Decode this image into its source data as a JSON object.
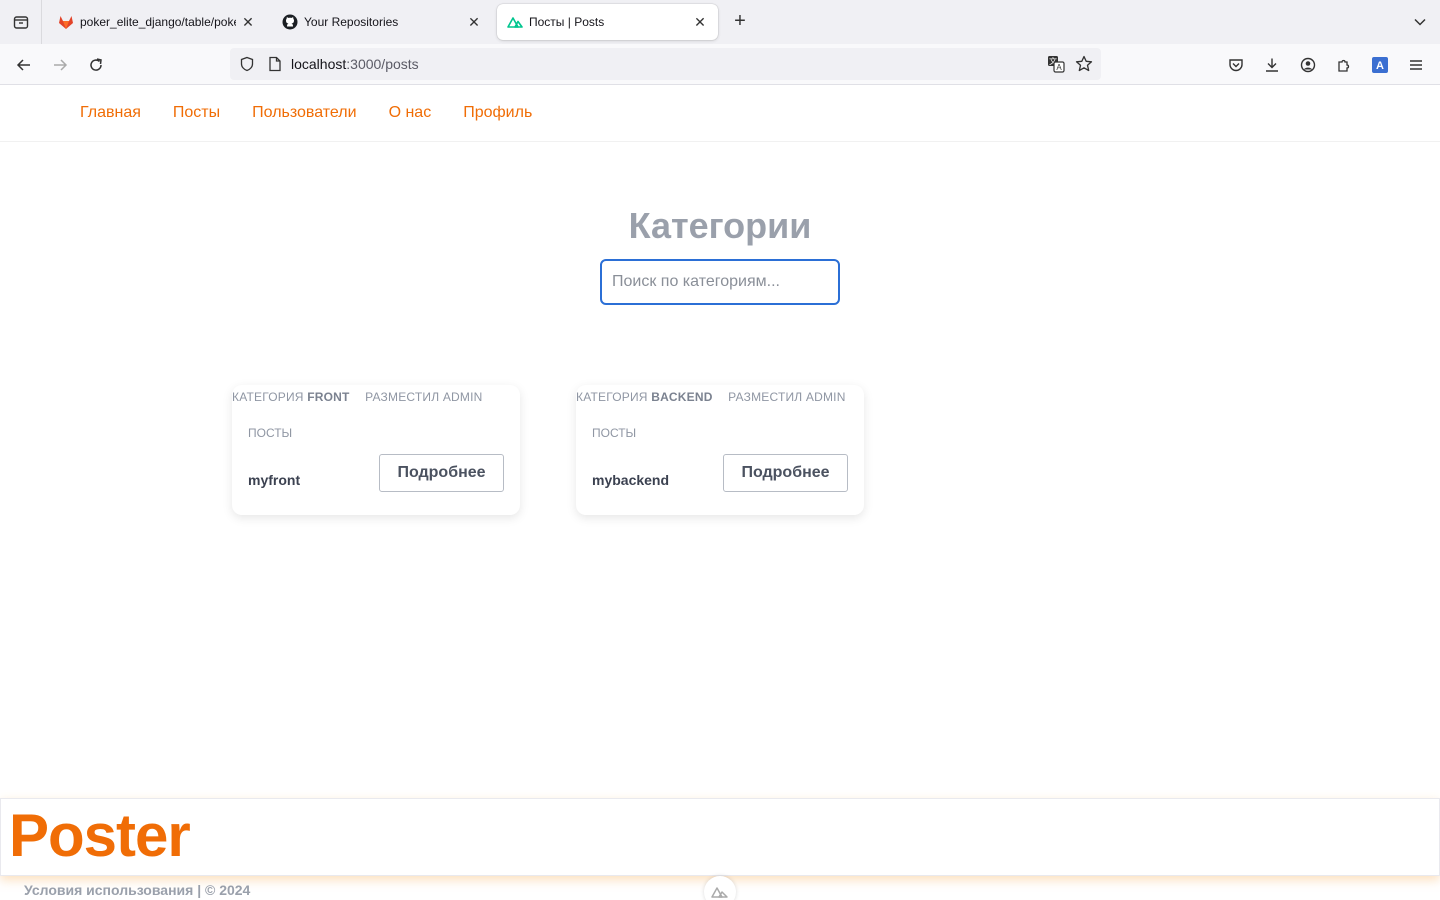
{
  "browser": {
    "tabs": [
      {
        "title": "poker_elite_django/table/poker_",
        "icon": "gitlab-icon",
        "active": false
      },
      {
        "title": "Your Repositories",
        "icon": "github-icon",
        "active": false
      },
      {
        "title": "Посты | Posts",
        "icon": "nuxt-icon",
        "active": true
      }
    ],
    "url": {
      "host": "localhost",
      "rest": ":3000/posts"
    }
  },
  "site_nav": {
    "items": [
      "Главная",
      "Посты",
      "Пользователи",
      "О нас",
      "Профиль"
    ],
    "color": "#f06d06"
  },
  "main": {
    "title": "Категории",
    "search": {
      "placeholder": "Поиск по категориям...",
      "value": ""
    }
  },
  "cards": [
    {
      "category_prefix": "КАТЕГОРИЯ",
      "category": "FRONT",
      "author": "РАЗМЕСТИЛ ADMIN",
      "posts_label": "ПОСТЫ",
      "name": "myfront",
      "button": "Подробнее"
    },
    {
      "category_prefix": "КАТЕГОРИЯ",
      "category": "BACKEND",
      "author": "РАЗМЕСТИЛ ADMIN",
      "posts_label": "ПОСТЫ",
      "name": "mybackend",
      "button": "Подробнее"
    }
  ],
  "footer": {
    "logo": "Poster",
    "text": "Условия использования | © 2024"
  }
}
